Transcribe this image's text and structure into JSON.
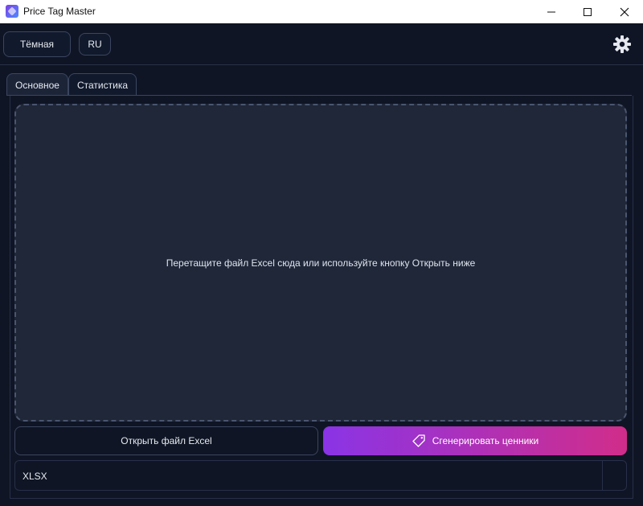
{
  "window": {
    "title": "Price Tag Master"
  },
  "topbar": {
    "theme_label": "Тёмная",
    "language_label": "RU"
  },
  "tabs": [
    {
      "label": "Основное",
      "active": true
    },
    {
      "label": "Статистика",
      "active": false
    }
  ],
  "dropzone": {
    "text": "Перетащите файл Excel сюда или используйте кнопку Открыть ниже"
  },
  "actions": {
    "open_label": "Открыть файл Excel",
    "generate_label": "Сгенерировать ценники"
  },
  "format": {
    "selected": "XLSX"
  },
  "colors": {
    "background": "#0f1524",
    "dropzone": "#1f2738",
    "gradient_start": "#8a34e6",
    "gradient_end": "#d12d8a"
  },
  "icons": {
    "app": "app-logo-icon",
    "settings": "gear-icon",
    "generate": "price-tag-icon"
  }
}
